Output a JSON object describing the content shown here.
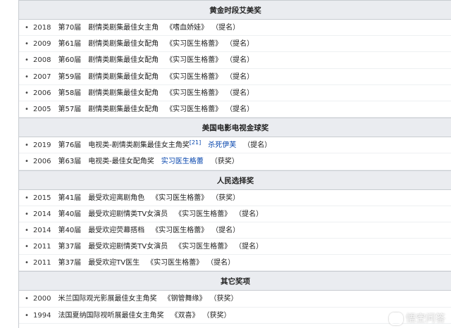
{
  "sections": [
    {
      "title": "黄金时段艾美奖",
      "rows": [
        {
          "year": "2018",
          "session": "第70届",
          "category": "剧情类剧集最佳女主角",
          "work": "《嗜血娇娃》",
          "result": "（提名）"
        },
        {
          "year": "2009",
          "session": "第61届",
          "category": "剧情类剧集最佳女配角",
          "work": "《实习医生格蕾》",
          "result": "（提名）"
        },
        {
          "year": "2008",
          "session": "第60届",
          "category": "剧情类剧集最佳女配角",
          "work": "《实习医生格蕾》",
          "result": "（提名）"
        },
        {
          "year": "2007",
          "session": "第59届",
          "category": "剧情类剧集最佳女配角",
          "work": "《实习医生格蕾》",
          "result": "（提名）"
        },
        {
          "year": "2006",
          "session": "第58届",
          "category": "剧情类剧集最佳女配角",
          "work": "《实习医生格蕾》",
          "result": "（提名）"
        },
        {
          "year": "2005",
          "session": "第57届",
          "category": "剧情类剧集最佳女配角",
          "work": "《实习医生格蕾》",
          "result": "（提名）"
        }
      ]
    },
    {
      "title": "美国电影电视金球奖",
      "rows": [
        {
          "year": "2019",
          "session": "第76届",
          "category": "电视类-剧情类剧集最佳女主角奖",
          "ref": "[21]",
          "work": "杀死伊芙",
          "result": "（提名）"
        },
        {
          "year": "2006",
          "session": "第63届",
          "category": "电视类-最佳女配角奖",
          "work": "实习医生格蕾",
          "result": "（获奖）"
        }
      ]
    },
    {
      "title": "人民选择奖",
      "rows": [
        {
          "year": "2015",
          "session": "第41届",
          "category": "最受欢迎离剧角色",
          "work": "《实习医生格蕾》",
          "result": "（获奖）"
        },
        {
          "year": "2014",
          "session": "第40届",
          "category": "最受欢迎剧情类TV女演员",
          "work": "《实习医生格蕾》",
          "result": "（提名）"
        },
        {
          "year": "2014",
          "session": "第40届",
          "category": "最受欢迎荧幕搭档",
          "work": "《实习医生格蕾》",
          "result": "（提名）"
        },
        {
          "year": "2011",
          "session": "第37届",
          "category": "最受欢迎剧情类TV女演员",
          "work": "《实习医生格蕾》",
          "result": "（提名）"
        },
        {
          "year": "2011",
          "session": "第37届",
          "category": "最受欢迎TV医生",
          "work": "《实习医生格蕾》",
          "result": "（提名）"
        }
      ]
    },
    {
      "title": "其它奖项",
      "rows": [
        {
          "year": "2000",
          "session": "",
          "category": "米兰国际观光影展最佳女主角奖",
          "work": "《钢管舞缘》",
          "result": "（获奖）"
        },
        {
          "year": "1994",
          "session": "",
          "category": "法国夏纳国际视听展最佳女主角奖",
          "work": "《双喜》",
          "result": "（获奖）"
        }
      ]
    }
  ],
  "watermark": "悟空问答"
}
